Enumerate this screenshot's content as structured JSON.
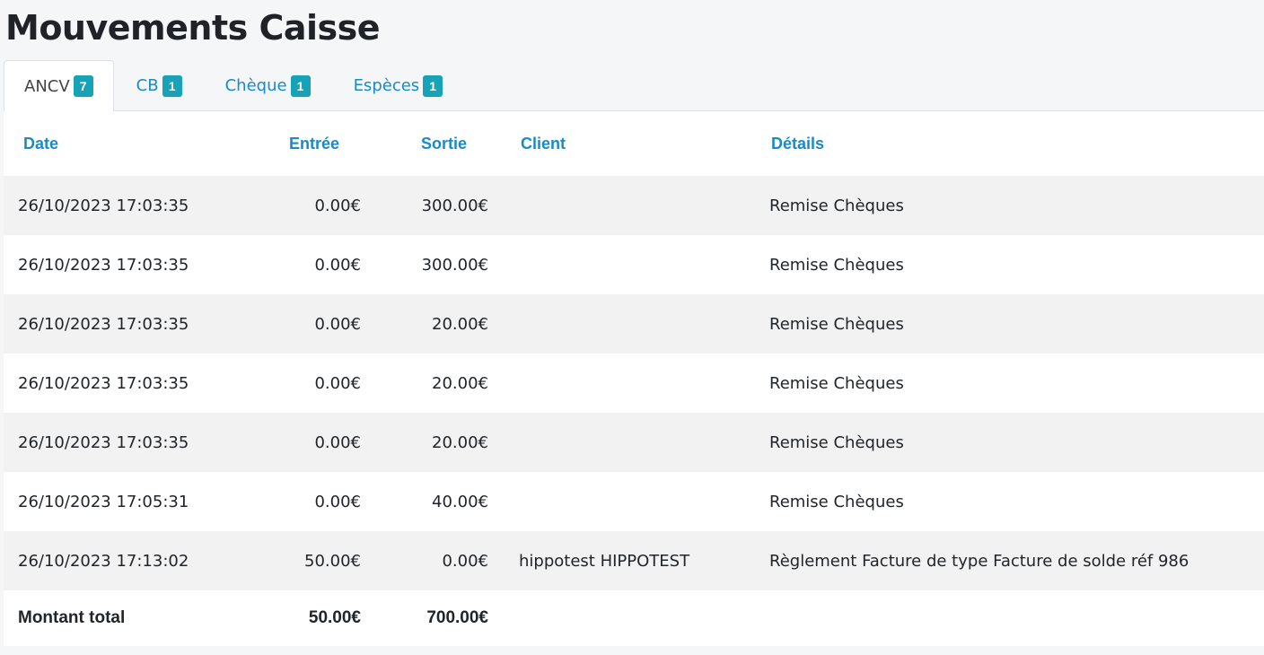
{
  "page": {
    "title": "Mouvements Caisse"
  },
  "tabs": [
    {
      "label": "ANCV",
      "count": "7",
      "active": true
    },
    {
      "label": "CB",
      "count": "1",
      "active": false
    },
    {
      "label": "Chèque",
      "count": "1",
      "active": false
    },
    {
      "label": "Espèces",
      "count": "1",
      "active": false
    }
  ],
  "table": {
    "headers": {
      "date": "Date",
      "entree": "Entrée",
      "sortie": "Sortie",
      "client": "Client",
      "details": "Détails"
    },
    "rows": [
      {
        "date": "26/10/2023 17:03:35",
        "entree": "0.00€",
        "sortie": "300.00€",
        "client": "",
        "details": "Remise Chèques"
      },
      {
        "date": "26/10/2023 17:03:35",
        "entree": "0.00€",
        "sortie": "300.00€",
        "client": "",
        "details": "Remise Chèques"
      },
      {
        "date": "26/10/2023 17:03:35",
        "entree": "0.00€",
        "sortie": "20.00€",
        "client": "",
        "details": "Remise Chèques"
      },
      {
        "date": "26/10/2023 17:03:35",
        "entree": "0.00€",
        "sortie": "20.00€",
        "client": "",
        "details": "Remise Chèques"
      },
      {
        "date": "26/10/2023 17:03:35",
        "entree": "0.00€",
        "sortie": "20.00€",
        "client": "",
        "details": "Remise Chèques"
      },
      {
        "date": "26/10/2023 17:05:31",
        "entree": "0.00€",
        "sortie": "40.00€",
        "client": "",
        "details": "Remise Chèques"
      },
      {
        "date": "26/10/2023 17:13:02",
        "entree": "50.00€",
        "sortie": "0.00€",
        "client": "hippotest HIPPOTEST",
        "details": "Règlement Facture de type Facture de solde réf 986"
      }
    ],
    "footer": {
      "label": "Montant total",
      "entree": "50.00€",
      "sortie": "700.00€"
    }
  },
  "colors": {
    "link": "#1a8ac7",
    "badge": "#17a2b8",
    "row_striped": "#f2f2f2"
  }
}
